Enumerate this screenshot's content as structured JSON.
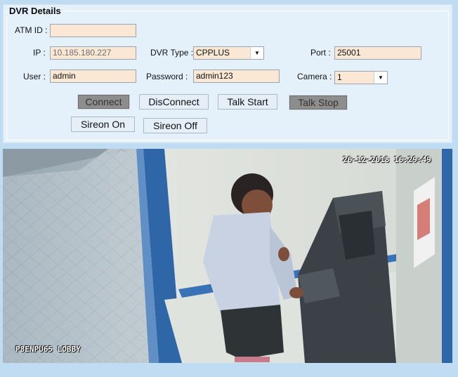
{
  "group": {
    "title": "DVR Details"
  },
  "fields": {
    "atm_id": {
      "label": "ATM ID :",
      "value": ""
    },
    "ip": {
      "label": "IP :",
      "value": "10.185.180.227"
    },
    "dvr_type": {
      "label": "DVR Type :",
      "value": "CPPLUS"
    },
    "port": {
      "label": "Port :",
      "value": "25001"
    },
    "user": {
      "label": "User :",
      "value": "admin"
    },
    "password": {
      "label": "Password :",
      "value": "admin123"
    },
    "camera": {
      "label": "Camera :",
      "value": "1"
    }
  },
  "buttons": {
    "connect": "Connect",
    "disconnect": "DisConnect",
    "talk_start": "Talk Start",
    "talk_stop": "Talk Stop",
    "sireon_on": "Sireon On",
    "sireon_off": "Sireon Off"
  },
  "video": {
    "timestamp": "26-12-2018 16:29:49",
    "camera_label": "P8ENPU65 LOBBY"
  },
  "icons": {
    "dropdown": "chevron-down-icon"
  },
  "colors": {
    "background": "#bfdcf3",
    "panel": "#e4f1fb",
    "input_fill": "#fae8d5",
    "button_active": "#8d8d8d"
  }
}
